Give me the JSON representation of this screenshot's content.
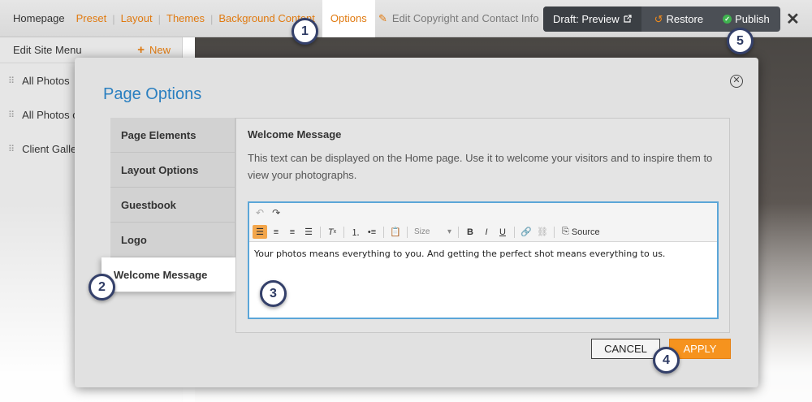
{
  "nav": {
    "items": [
      "Homepage",
      "Preset",
      "Layout",
      "Themes",
      "Background Content",
      "Options"
    ],
    "edit_copyright": "Edit Copyright and Contact Info"
  },
  "actions": {
    "draft_preview": "Draft: Preview",
    "restore": "Restore",
    "publish": "Publish"
  },
  "sidebar": {
    "title": "Edit Site Menu",
    "new_label": "New",
    "items": [
      "All Photos",
      "All Photos o",
      "Client Galle"
    ]
  },
  "modal": {
    "title": "Page Options",
    "tabs": [
      "Page Elements",
      "Layout Options",
      "Guestbook",
      "Logo",
      "Welcome Message"
    ],
    "active_tab": "Welcome Message",
    "section_title": "Welcome Message",
    "description": "This text can be displayed on the Home page. Use it to welcome your visitors and to inspire them to view your photographs.",
    "editor": {
      "size_placeholder": "Size",
      "source_label": "Source",
      "content": "Your photos means everything to you. And getting the perfect shot means everything to us."
    },
    "cancel": "CANCEL",
    "apply": "APPLY"
  },
  "markers": [
    "1",
    "2",
    "3",
    "4",
    "5"
  ],
  "colors": {
    "accent_orange": "#f6931e",
    "title_blue": "#2a7fc0",
    "marker_navy": "#34406a",
    "publish_green": "#3fb34f"
  }
}
